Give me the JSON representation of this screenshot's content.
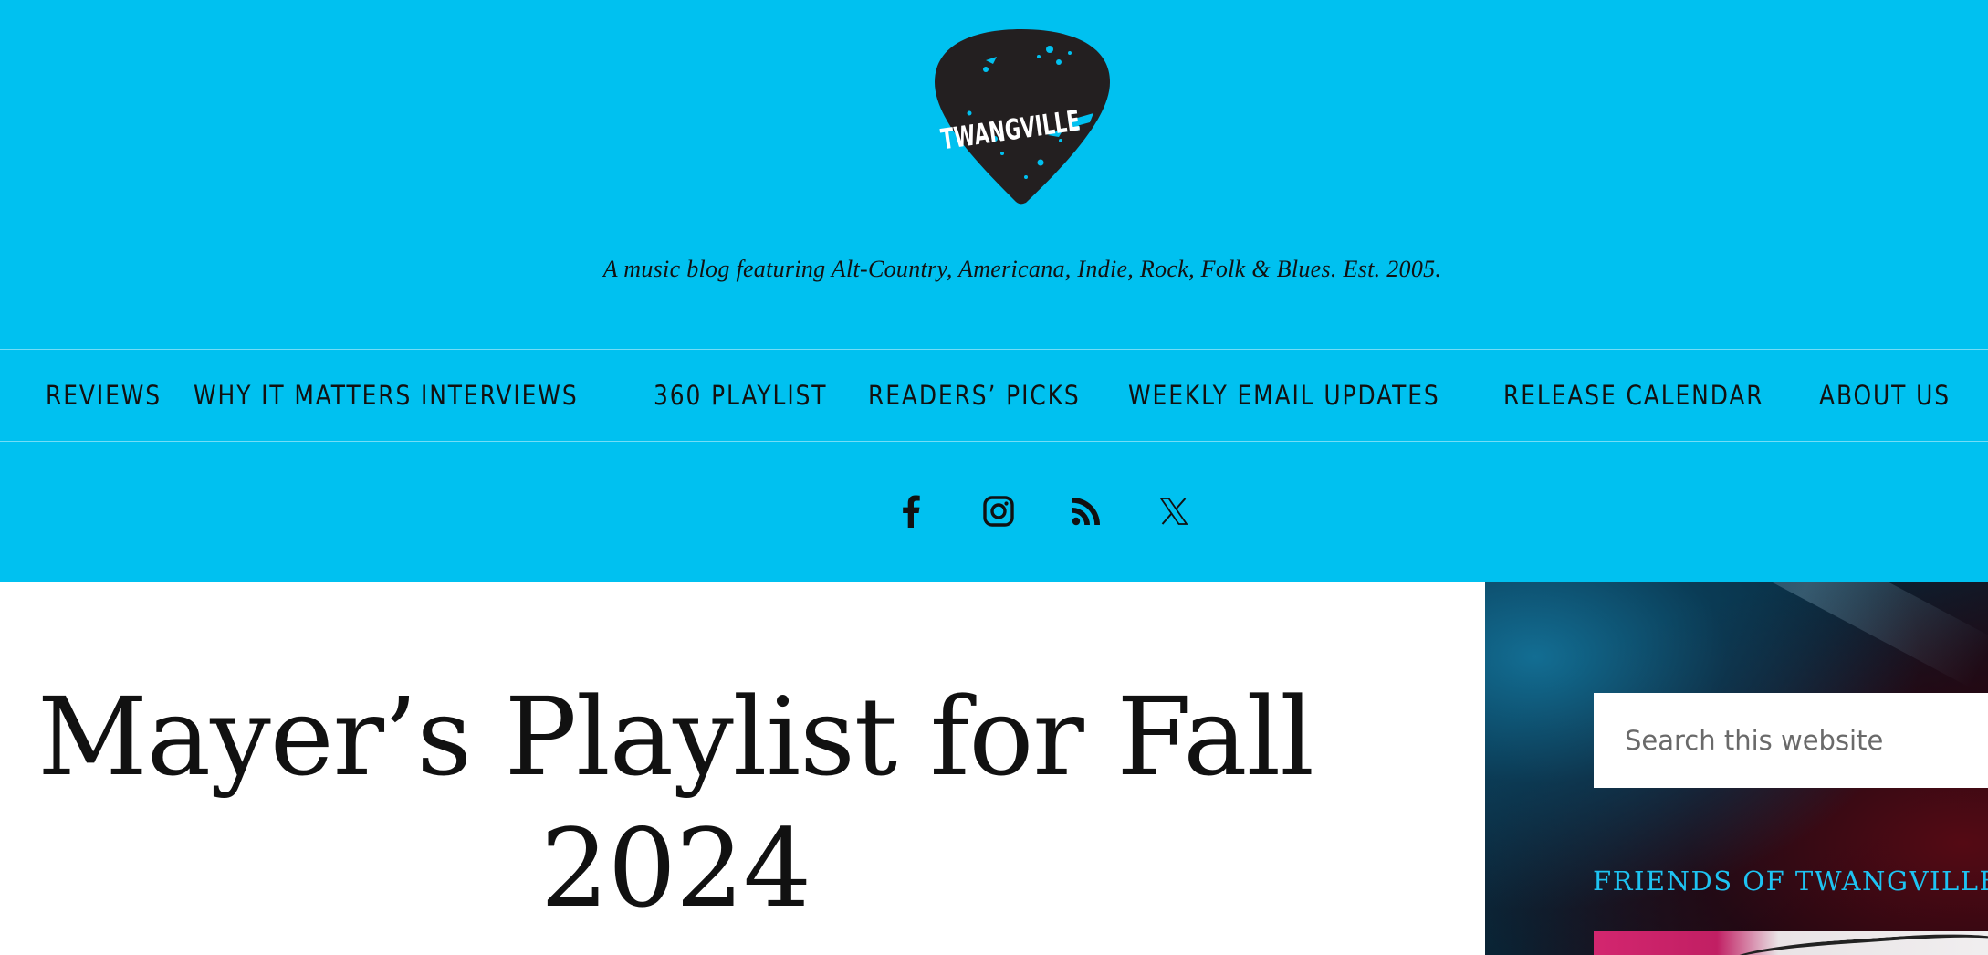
{
  "site": {
    "logo_text": "TWANGVILLE",
    "tagline": "A music blog featuring Alt-Country, Americana, Indie, Rock, Folk & Blues. Est. 2005.",
    "brand_color": "#00c1f0",
    "accent_color": "#1ec3f2"
  },
  "nav": {
    "items": [
      {
        "label": "REVIEWS"
      },
      {
        "label": "WHY IT MATTERS INTERVIEWS"
      },
      {
        "label": "360 PLAYLIST"
      },
      {
        "label": "READERS’ PICKS"
      },
      {
        "label": "WEEKLY EMAIL UPDATES"
      },
      {
        "label": "RELEASE CALENDAR"
      },
      {
        "label": "ABOUT US"
      }
    ]
  },
  "social": {
    "icons": [
      "facebook-icon",
      "instagram-icon",
      "rss-icon",
      "x-icon"
    ]
  },
  "article": {
    "title": "Mayer’s Playlist for Fall 2024"
  },
  "sidebar": {
    "search_placeholder": "Search this website",
    "friends_heading": "FRIENDS OF TWANGVILLE"
  }
}
